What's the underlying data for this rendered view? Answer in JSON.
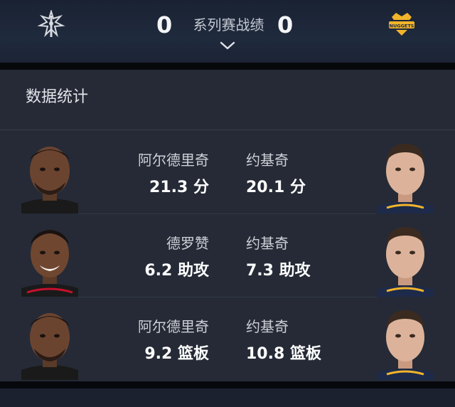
{
  "header": {
    "home_team_icon": "spurs-logo",
    "away_team_icon": "nuggets-logo",
    "away_team_logo_text": "NUGGETS",
    "home_score": "0",
    "away_score": "0",
    "series_label": "系列赛战绩"
  },
  "stats": {
    "title": "数据统计",
    "rows": [
      {
        "left_player": "阿尔德里奇",
        "left_value": "21.3 分",
        "right_player": "约基奇",
        "right_value": "20.1 分"
      },
      {
        "left_player": "德罗赞",
        "left_value": "6.2 助攻",
        "right_player": "约基奇",
        "right_value": "7.3 助攻"
      },
      {
        "left_player": "阿尔德里奇",
        "left_value": "9.2 篮板",
        "right_player": "约基奇",
        "right_value": "10.8 篮板"
      }
    ]
  },
  "colors": {
    "header_bg": "#1f2a3d",
    "panel_bg": "#252a36",
    "nuggets_gold": "#f2b52a",
    "spurs_silver": "#c4ced4"
  }
}
